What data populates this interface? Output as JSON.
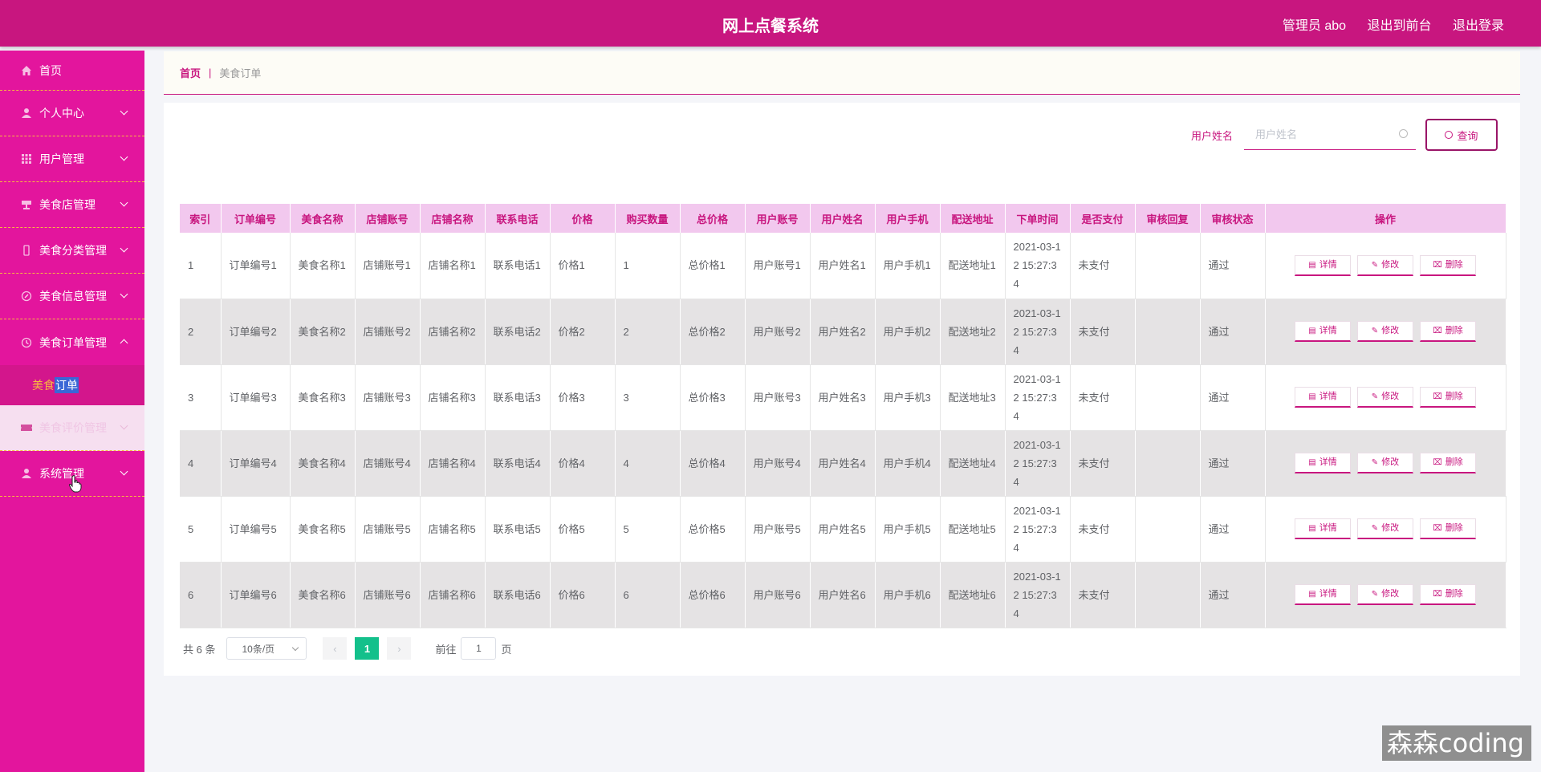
{
  "header": {
    "title": "网上点餐系统",
    "admin": "管理员 abo",
    "to_front": "退出到前台",
    "logout": "退出登录"
  },
  "sidebar": {
    "items": [
      {
        "label": "首页",
        "icon": "home-icon"
      },
      {
        "label": "个人中心",
        "icon": "user-icon"
      },
      {
        "label": "用户管理",
        "icon": "grid-icon"
      },
      {
        "label": "美食店管理",
        "icon": "store-icon"
      },
      {
        "label": "美食分类管理",
        "icon": "phone-icon"
      },
      {
        "label": "美食信息管理",
        "icon": "compass-icon"
      },
      {
        "label": "美食订单管理",
        "icon": "clock-icon"
      },
      {
        "label": "美食评价管理",
        "icon": "ticket-icon"
      },
      {
        "label": "系统管理",
        "icon": "user-icon"
      }
    ],
    "submenu": {
      "part1": "美食",
      "part2": "订单"
    }
  },
  "breadcrumb": {
    "home": "首页",
    "separator": "|",
    "current": "美食订单"
  },
  "search": {
    "label": "用户姓名",
    "placeholder": "用户姓名",
    "button": "查询"
  },
  "table": {
    "headers": [
      "索引",
      "订单编号",
      "美食名称",
      "店铺账号",
      "店铺名称",
      "联系电话",
      "价格",
      "购买数量",
      "总价格",
      "用户账号",
      "用户姓名",
      "用户手机",
      "配送地址",
      "下单时间",
      "是否支付",
      "审核回复",
      "审核状态",
      "操作"
    ],
    "rows": [
      [
        "1",
        "订单编号1",
        "美食名称1",
        "店铺账号1",
        "店铺名称1",
        "联系电话1",
        "价格1",
        "1",
        "总价格1",
        "用户账号1",
        "用户姓名1",
        "用户手机1",
        "配送地址1",
        "2021-03-12 15:27:34",
        "未支付",
        "",
        "通过"
      ],
      [
        "2",
        "订单编号2",
        "美食名称2",
        "店铺账号2",
        "店铺名称2",
        "联系电话2",
        "价格2",
        "2",
        "总价格2",
        "用户账号2",
        "用户姓名2",
        "用户手机2",
        "配送地址2",
        "2021-03-12 15:27:34",
        "未支付",
        "",
        "通过"
      ],
      [
        "3",
        "订单编号3",
        "美食名称3",
        "店铺账号3",
        "店铺名称3",
        "联系电话3",
        "价格3",
        "3",
        "总价格3",
        "用户账号3",
        "用户姓名3",
        "用户手机3",
        "配送地址3",
        "2021-03-12 15:27:34",
        "未支付",
        "",
        "通过"
      ],
      [
        "4",
        "订单编号4",
        "美食名称4",
        "店铺账号4",
        "店铺名称4",
        "联系电话4",
        "价格4",
        "4",
        "总价格4",
        "用户账号4",
        "用户姓名4",
        "用户手机4",
        "配送地址4",
        "2021-03-12 15:27:34",
        "未支付",
        "",
        "通过"
      ],
      [
        "5",
        "订单编号5",
        "美食名称5",
        "店铺账号5",
        "店铺名称5",
        "联系电话5",
        "价格5",
        "5",
        "总价格5",
        "用户账号5",
        "用户姓名5",
        "用户手机5",
        "配送地址5",
        "2021-03-12 15:27:34",
        "未支付",
        "",
        "通过"
      ],
      [
        "6",
        "订单编号6",
        "美食名称6",
        "店铺账号6",
        "店铺名称6",
        "联系电话6",
        "价格6",
        "6",
        "总价格6",
        "用户账号6",
        "用户姓名6",
        "用户手机6",
        "配送地址6",
        "2021-03-12 15:27:34",
        "未支付",
        "",
        "通过"
      ]
    ],
    "actions": {
      "detail": "详情",
      "edit": "修改",
      "delete": "删除"
    }
  },
  "pagination": {
    "total": "共 6 条",
    "page_size": "10条/页",
    "prev": "‹",
    "current_page": "1",
    "next": "›",
    "goto_prefix": "前往",
    "goto_value": "1",
    "goto_suffix": "页"
  },
  "watermark": "森森coding",
  "colors": {
    "primary": "#c8167f",
    "sidebar": "#e3159d",
    "accent": "#f7b93f",
    "page_active": "#13c08b"
  }
}
